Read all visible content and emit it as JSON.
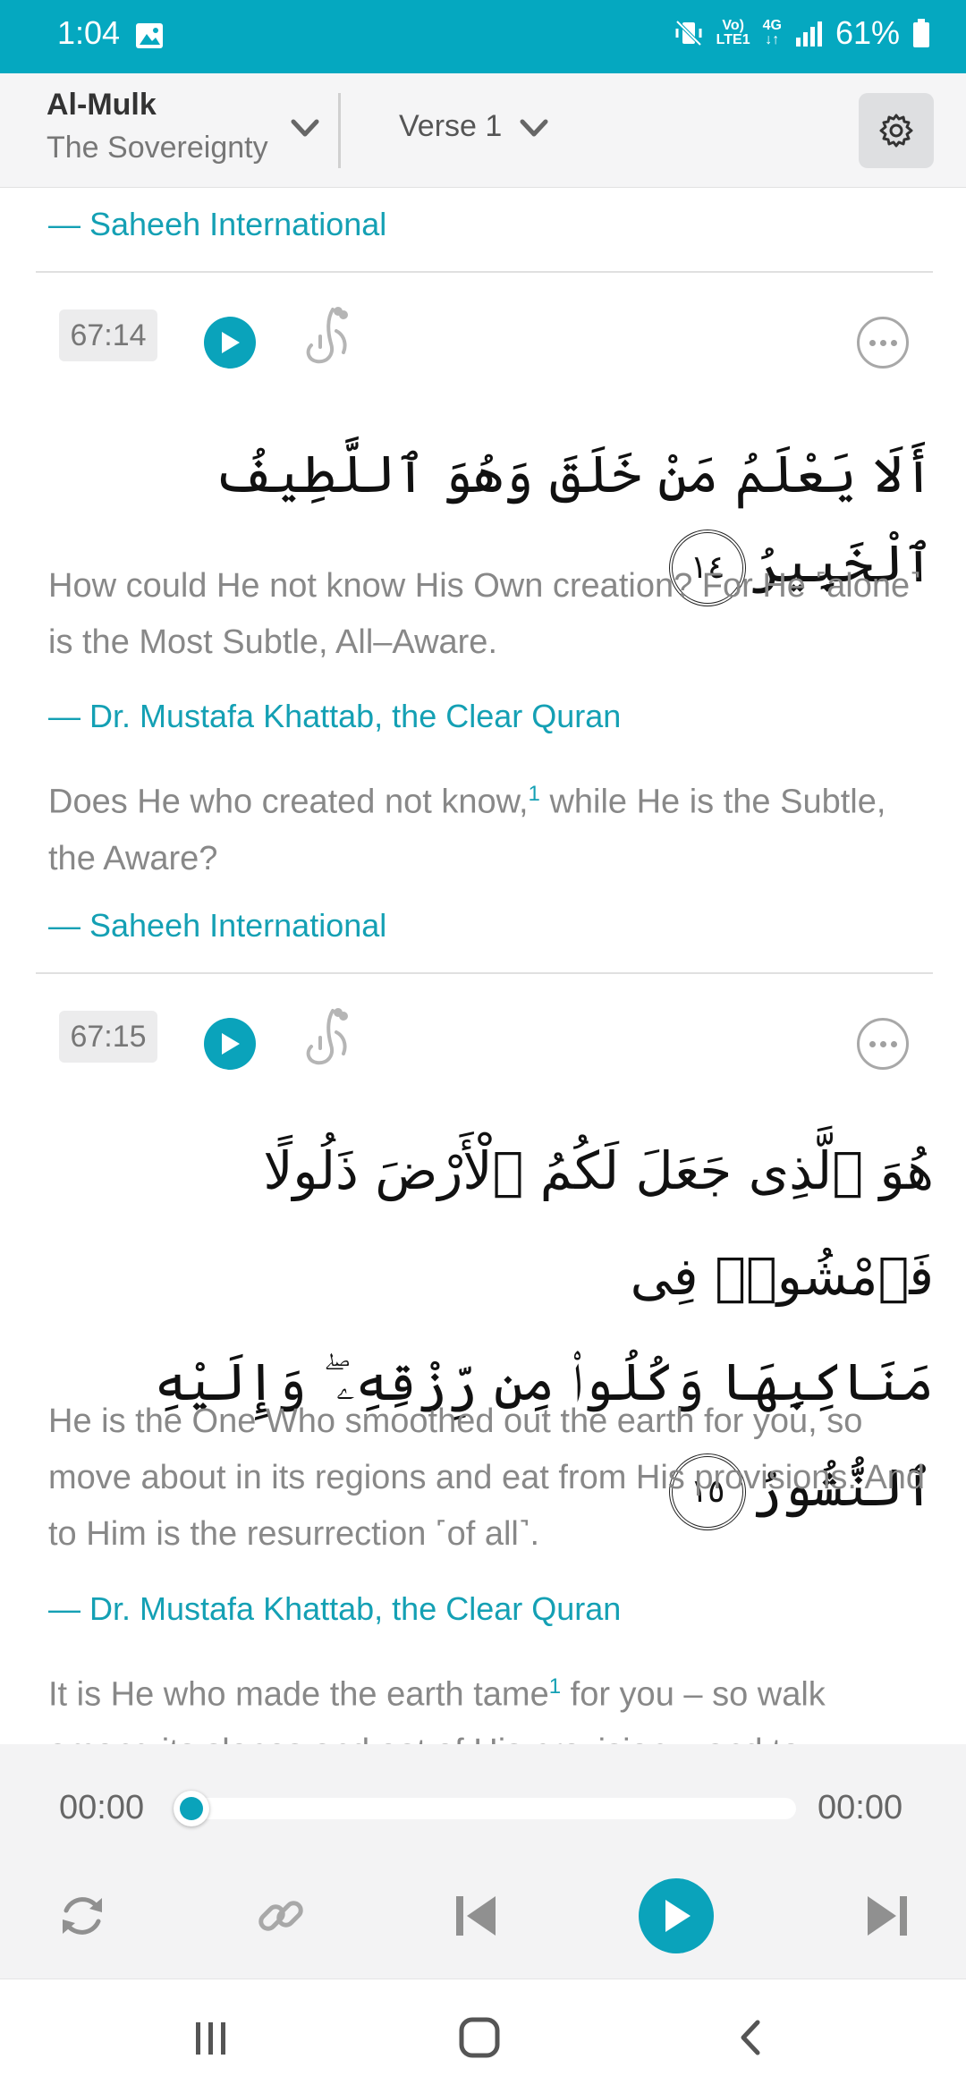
{
  "status_bar": {
    "time": "1:04",
    "network_top": "Vo)",
    "network_bottom": "LTE1",
    "network_type": "4G",
    "battery": "61%"
  },
  "header": {
    "surah_name": "Al-Mulk",
    "surah_translation": "The Sovereignty",
    "verse_selector": "Verse 1"
  },
  "prev_attribution": "— Saheeh International",
  "verses": [
    {
      "ref": "67:14",
      "arabic": "أَلَا يَعْلَمُ مَنْ خَلَقَ وَهُوَ ٱللَّطِيفُ ٱلْخَبِيرُ",
      "ayah_number": "١٤",
      "translation_1": "How could He not know His Own creation? For He ˹alone˺ is the Most Subtle, All–Aware.",
      "attribution_1": "— Dr. Mustafa Khattab, the Clear Quran",
      "translation_2_pre": "Does He who created not know,",
      "translation_2_footnote": "1",
      "translation_2_post": " while He is the Subtle, the Aware?",
      "attribution_2": "— Saheeh International"
    },
    {
      "ref": "67:15",
      "arabic_line_1": "هُوَ ٱلَّذِى جَعَلَ لَكُمُ ٱلْأَرْضَ ذَلُولًا فَٱمْشُوا۟ فِى",
      "arabic_line_2": "مَنَاكِبِهَا وَكُلُوا۟ مِن رِّزْقِهِۦ ۖ وَإِلَيْهِ ٱلنُّشُورُ",
      "ayah_number": "١٥",
      "translation_1": "He is the One Who smoothed out the earth for you, so move about in its regions and eat from His provisions. And to Him is the resurrection ˹of all˺.",
      "attribution_1": "— Dr. Mustafa Khattab, the Clear Quran",
      "translation_2_pre": "It is He who made the earth tame",
      "translation_2_footnote": "1",
      "translation_2_post": " for you – so walk among its slopes and eat of His provision – and to"
    }
  ],
  "player": {
    "current_time": "00:00",
    "total_time": "00:00",
    "progress": 0
  },
  "colors": {
    "accent": "#0aa3bb",
    "status_bar": "#05a8c0"
  }
}
